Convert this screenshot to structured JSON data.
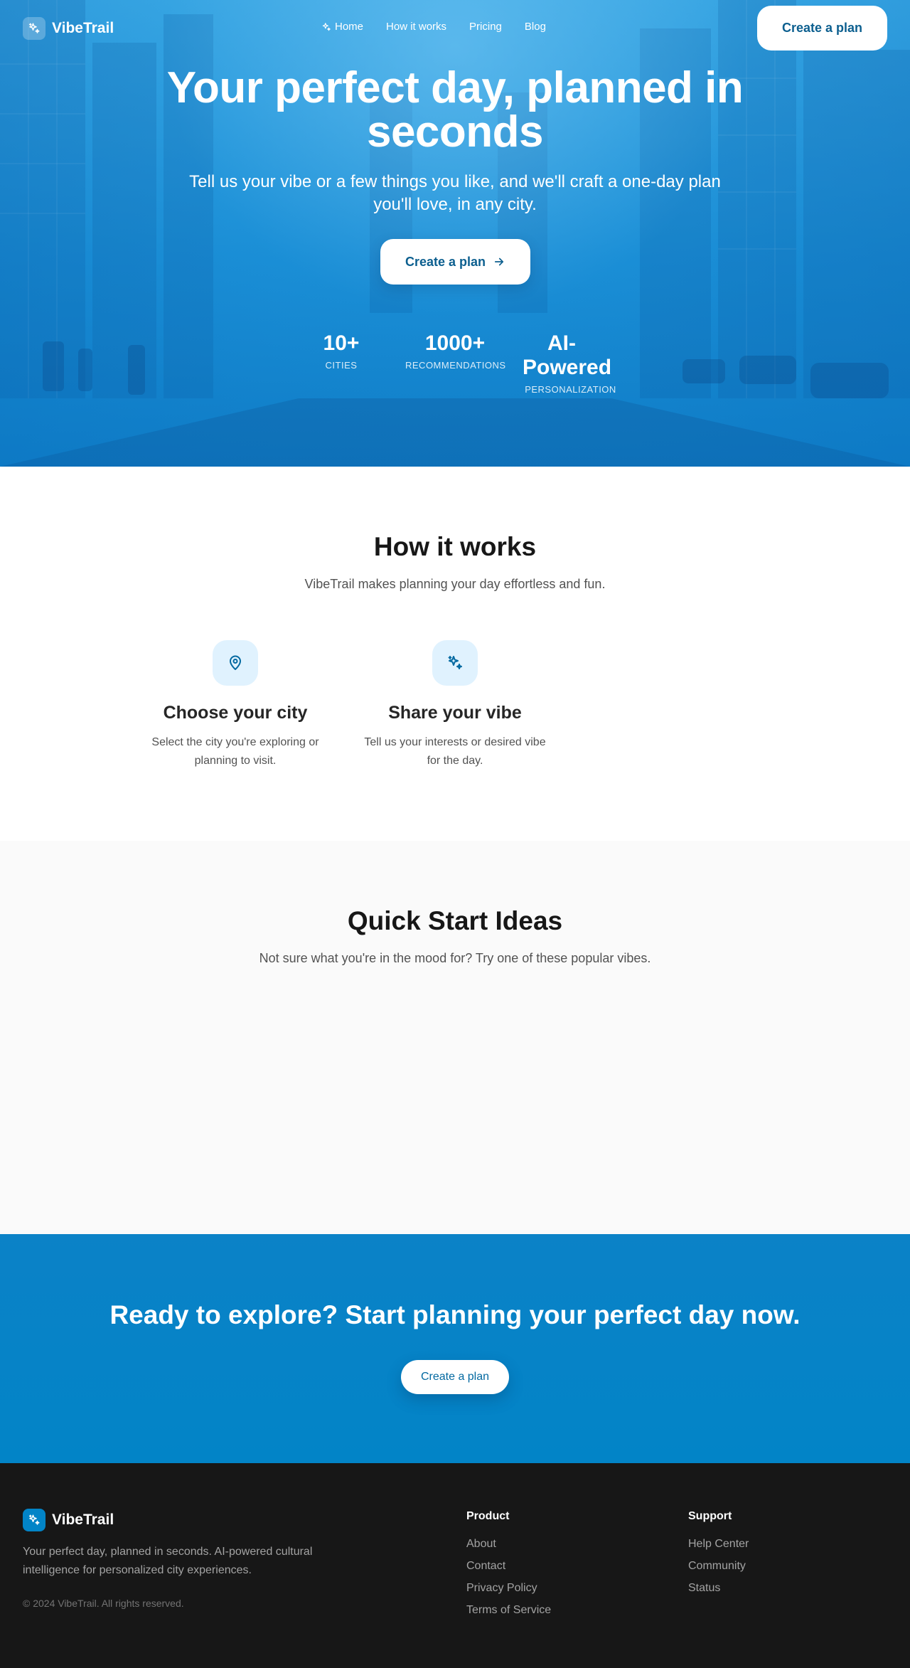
{
  "brand": {
    "name": "VibeTrail",
    "logo_icon": "sparkles-icon"
  },
  "nav": {
    "links": [
      {
        "label": "Home",
        "icon": "sparkles-icon"
      },
      {
        "label": "How it works"
      },
      {
        "label": "Pricing"
      },
      {
        "label": "Blog"
      }
    ],
    "cta_label": "Create a plan"
  },
  "hero": {
    "title": "Your perfect day, planned in seconds",
    "subtitle": "Tell us your vibe or a few things you like, and we'll craft a one-day plan you'll love, in any city.",
    "cta_label": "Create a plan",
    "cta_icon": "arrow-right-icon",
    "stats": [
      {
        "value": "10+",
        "label": "CITIES"
      },
      {
        "value": "1000+",
        "label": "RECOMMENDATIONS"
      },
      {
        "value": "AI-Powered",
        "label": "PERSONALIZATION"
      }
    ]
  },
  "how_it_works": {
    "title": "How it works",
    "subtitle": "VibeTrail makes planning your day effortless and fun.",
    "steps": [
      {
        "icon": "map-pin-icon",
        "title": "Choose your city",
        "description": "Select the city you're exploring or planning to visit."
      },
      {
        "icon": "sparkles-icon",
        "title": "Share your vibe",
        "description": "Tell us your interests or desired vibe for the day."
      }
    ]
  },
  "quick_start": {
    "title": "Quick Start Ideas",
    "subtitle": "Not sure what you're in the mood for? Try one of these popular vibes."
  },
  "cta_band": {
    "title": "Ready to explore? Start planning your perfect day now.",
    "button_label": "Create a plan"
  },
  "footer": {
    "brand": "VibeTrail",
    "description": "Your perfect day, planned in seconds. AI-powered cultural intelligence for personalized city experiences.",
    "copyright": "© 2024 VibeTrail. All rights reserved.",
    "columns": [
      {
        "title": "Product",
        "links": [
          "About",
          "Contact",
          "Privacy Policy",
          "Terms of Service"
        ]
      },
      {
        "title": "Support",
        "links": [
          "Help Center",
          "Community",
          "Status"
        ]
      }
    ]
  },
  "colors": {
    "primary": "#0284c7",
    "primary_dark": "#0c5f8f",
    "icon_bg": "#e0f2fe",
    "footer_bg": "#171717",
    "quick_bg": "#fafafa"
  }
}
